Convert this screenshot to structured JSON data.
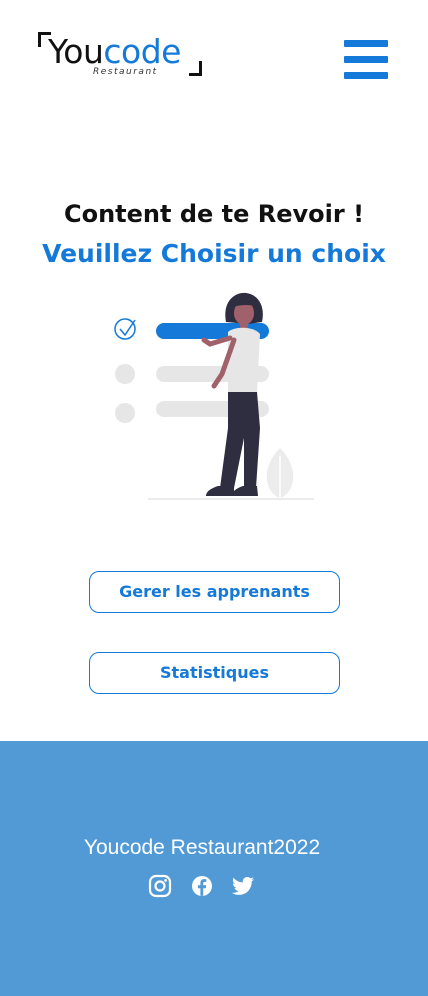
{
  "header": {
    "logo": {
      "brand_part1": "You",
      "brand_part2": "code",
      "tagline": "Restaurant"
    },
    "menu_icon": "hamburger-menu-icon"
  },
  "main": {
    "greeting": "Content de te Revoir !",
    "prompt": "Veuillez Choisir un choix",
    "illustration": "person-checklist-illustration",
    "buttons": {
      "manage_learners": "Gerer les apprenants",
      "statistics": "Statistiques"
    }
  },
  "footer": {
    "copyright": "Youcode Restaurant2022",
    "social_icons": [
      "instagram-icon",
      "facebook-icon",
      "twitter-icon"
    ]
  },
  "colors": {
    "accent": "#1479d8",
    "footer_bg": "#519ad6",
    "text_dark": "#111111"
  }
}
